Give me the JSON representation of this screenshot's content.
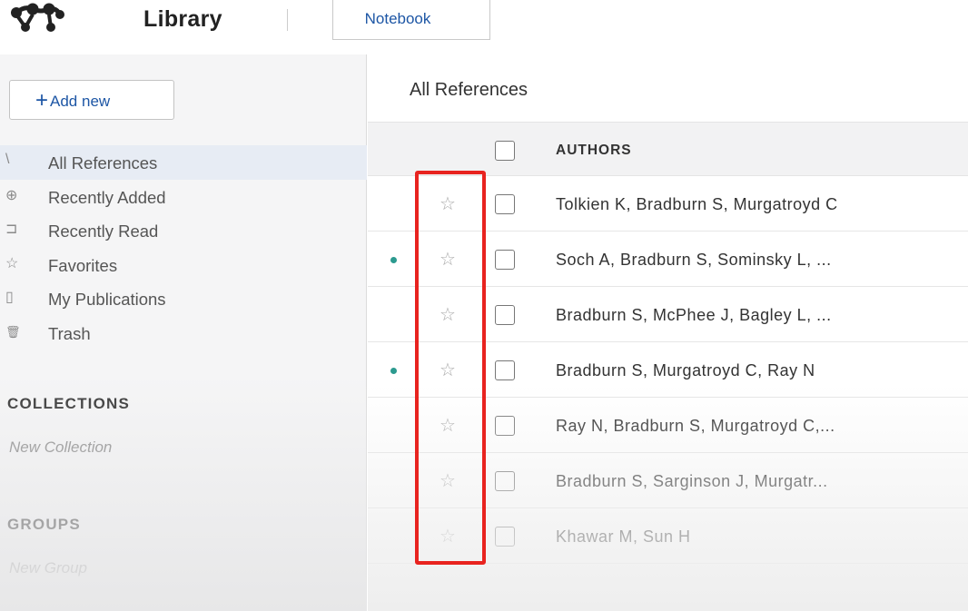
{
  "header": {
    "app_title": "Library",
    "tab_notebook": "Notebook"
  },
  "sidebar": {
    "add_new_label": "Add new",
    "add_new_plus": "+",
    "nav": [
      {
        "label": "All References",
        "icon": "library-icon",
        "glyph": "\\",
        "active": true
      },
      {
        "label": "Recently Added",
        "icon": "clock-icon",
        "glyph": "⊕",
        "active": false
      },
      {
        "label": "Recently Read",
        "icon": "bookmark-icon",
        "glyph": "⊐",
        "active": false
      },
      {
        "label": "Favorites",
        "icon": "star-icon",
        "glyph": "☆",
        "active": false
      },
      {
        "label": "My Publications",
        "icon": "document-icon",
        "glyph": "▯",
        "active": false
      },
      {
        "label": "Trash",
        "icon": "trash-icon",
        "glyph": "🗑",
        "active": false
      }
    ],
    "collections_heading": "COLLECTIONS",
    "new_collection": "New Collection",
    "groups_heading": "GROUPS",
    "new_group": "New Group"
  },
  "main": {
    "title": "All References",
    "column_authors": "AUTHORS",
    "rows": [
      {
        "authors": "Tolkien K, Bradburn S, Murgatroyd C",
        "unread": false
      },
      {
        "authors": "Soch A, Bradburn S, Sominsky L, ...",
        "unread": true
      },
      {
        "authors": "Bradburn S, McPhee J, Bagley L, ...",
        "unread": false
      },
      {
        "authors": "Bradburn S, Murgatroyd C, Ray N",
        "unread": true
      },
      {
        "authors": "Ray N, Bradburn S, Murgatroyd C,...",
        "unread": false
      },
      {
        "authors": "Bradburn S, Sarginson J, Murgatr...",
        "unread": false
      },
      {
        "authors": "Khawar M, Sun H",
        "unread": false
      }
    ]
  },
  "colors": {
    "accent_blue": "#1d56a5",
    "unread_dot": "#2c9a8f",
    "highlight_red": "#e8231f"
  }
}
